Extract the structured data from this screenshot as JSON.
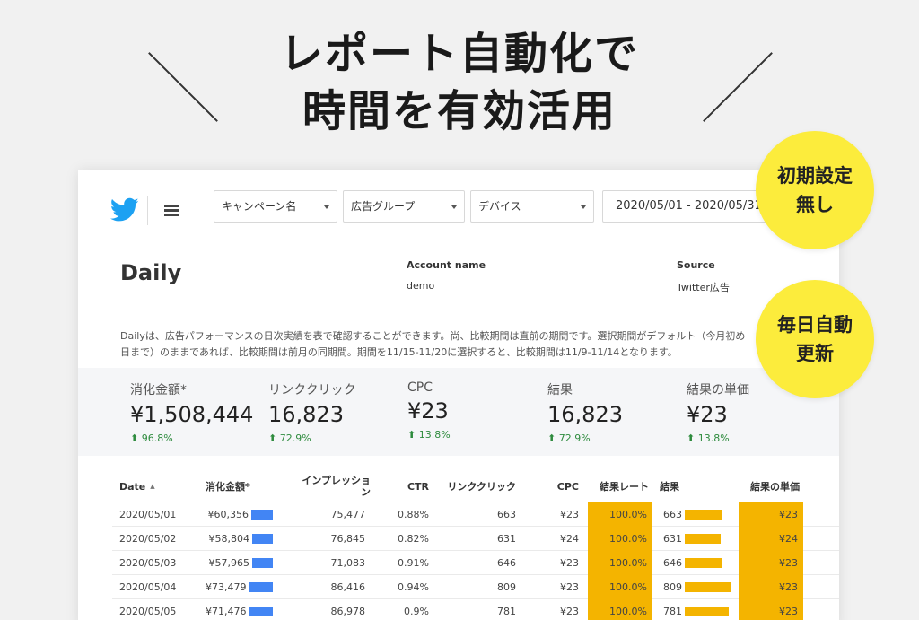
{
  "hero": {
    "line1": "レポート自動化で",
    "line2": "時間を有効活用"
  },
  "bubbles": [
    {
      "line1": "初期設定",
      "line2": "無し"
    },
    {
      "line1": "毎日自動",
      "line2": "更新"
    }
  ],
  "toolbar": {
    "filters": [
      "キャンペーン名",
      "広告グループ",
      "デバイス"
    ],
    "date_range": "2020/05/01 - 2020/05/31"
  },
  "report": {
    "title": "Daily",
    "account_label": "Account name",
    "account_value": "demo",
    "source_label": "Source",
    "source_value": "Twitter広告",
    "description_line1": "Dailyは、広告パフォーマンスの日次実績を表で確認することができます。尚、比較期間は直前の期間です。選択期間がデフォルト（今月初め",
    "description_line2": "日まで）のままであれば、比較期間は前月の同期間。期間を11/15-11/20に選択すると、比較期間は11/9-11/14となります。"
  },
  "kpis": [
    {
      "label": "消化金額*",
      "value": "¥1,508,444",
      "delta": "96.8%"
    },
    {
      "label": "リンククリック",
      "value": "16,823",
      "delta": "72.9%"
    },
    {
      "label": "CPC",
      "value": "¥23",
      "delta": "13.8%"
    },
    {
      "label": "結果",
      "value": "16,823",
      "delta": "72.9%"
    },
    {
      "label": "結果の単価",
      "value": "¥23",
      "delta": "13.8%"
    }
  ],
  "table": {
    "headers": {
      "date": "Date",
      "spend": "消化金額*",
      "impressions": "インプレッション",
      "ctr": "CTR",
      "link_clicks": "リンククリック",
      "cpc": "CPC",
      "result_rate": "結果レート",
      "results": "結果",
      "cost_per_result": "結果の単価"
    },
    "rows": [
      {
        "date": "2020/05/01",
        "spend": "¥60,356",
        "impressions": "75,477",
        "ctr": "0.88%",
        "link_clicks": "663",
        "cpc": "¥23",
        "result_rate": "100.0%",
        "results": "663",
        "cost_per_result": "¥23"
      },
      {
        "date": "2020/05/02",
        "spend": "¥58,804",
        "impressions": "76,845",
        "ctr": "0.82%",
        "link_clicks": "631",
        "cpc": "¥24",
        "result_rate": "100.0%",
        "results": "631",
        "cost_per_result": "¥24"
      },
      {
        "date": "2020/05/03",
        "spend": "¥57,965",
        "impressions": "71,083",
        "ctr": "0.91%",
        "link_clicks": "646",
        "cpc": "¥23",
        "result_rate": "100.0%",
        "results": "646",
        "cost_per_result": "¥23"
      },
      {
        "date": "2020/05/04",
        "spend": "¥73,479",
        "impressions": "86,416",
        "ctr": "0.94%",
        "link_clicks": "809",
        "cpc": "¥23",
        "result_rate": "100.0%",
        "results": "809",
        "cost_per_result": "¥23"
      },
      {
        "date": "2020/05/05",
        "spend": "¥71,476",
        "impressions": "86,978",
        "ctr": "0.9%",
        "link_clicks": "781",
        "cpc": "¥23",
        "result_rate": "100.0%",
        "results": "781",
        "cost_per_result": "¥23"
      }
    ]
  },
  "colors": {
    "accent_blue": "#1da1f2",
    "spend_bar": "#4285f4",
    "highlight": "#f4b400",
    "bubble": "#fcec3c",
    "positive": "#2e8b3e"
  },
  "icons": [
    "twitter-bird-icon",
    "menu-icon",
    "chevron-down-icon",
    "sort-up-icon",
    "arrow-up-icon"
  ]
}
